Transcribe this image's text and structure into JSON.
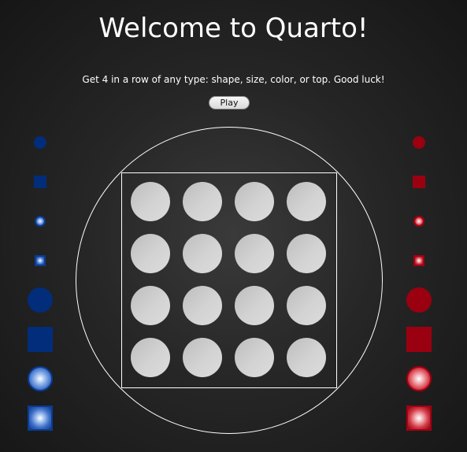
{
  "header": {
    "title": "Welcome to Quarto!",
    "subtitle": "Get 4 in a row of any type: shape, size, color, or top. Good luck!"
  },
  "controls": {
    "play_label": "Play"
  },
  "board": {
    "rows": 4,
    "cols": 4,
    "cells": [
      "empty",
      "empty",
      "empty",
      "empty",
      "empty",
      "empty",
      "empty",
      "empty",
      "empty",
      "empty",
      "empty",
      "empty",
      "empty",
      "empty",
      "empty",
      "empty"
    ]
  },
  "pieces": {
    "blue": [
      {
        "shape": "circle",
        "size": "small",
        "top": "solid"
      },
      {
        "shape": "square",
        "size": "small",
        "top": "solid"
      },
      {
        "shape": "circle",
        "size": "small",
        "top": "hollow"
      },
      {
        "shape": "square",
        "size": "small",
        "top": "hollow"
      },
      {
        "shape": "circle",
        "size": "large",
        "top": "solid"
      },
      {
        "shape": "square",
        "size": "large",
        "top": "solid"
      },
      {
        "shape": "circle",
        "size": "large",
        "top": "hollow"
      },
      {
        "shape": "square",
        "size": "large",
        "top": "hollow"
      }
    ],
    "red": [
      {
        "shape": "circle",
        "size": "small",
        "top": "solid"
      },
      {
        "shape": "square",
        "size": "small",
        "top": "solid"
      },
      {
        "shape": "circle",
        "size": "small",
        "top": "hollow"
      },
      {
        "shape": "square",
        "size": "small",
        "top": "hollow"
      },
      {
        "shape": "circle",
        "size": "large",
        "top": "solid"
      },
      {
        "shape": "square",
        "size": "large",
        "top": "solid"
      },
      {
        "shape": "circle",
        "size": "large",
        "top": "hollow"
      },
      {
        "shape": "square",
        "size": "large",
        "top": "hollow"
      }
    ]
  },
  "colors": {
    "background": "#1e1e1e",
    "cell": "#cfcfcf",
    "blue": "#022d7a",
    "red": "#9a0010",
    "line": "#ffffff"
  }
}
